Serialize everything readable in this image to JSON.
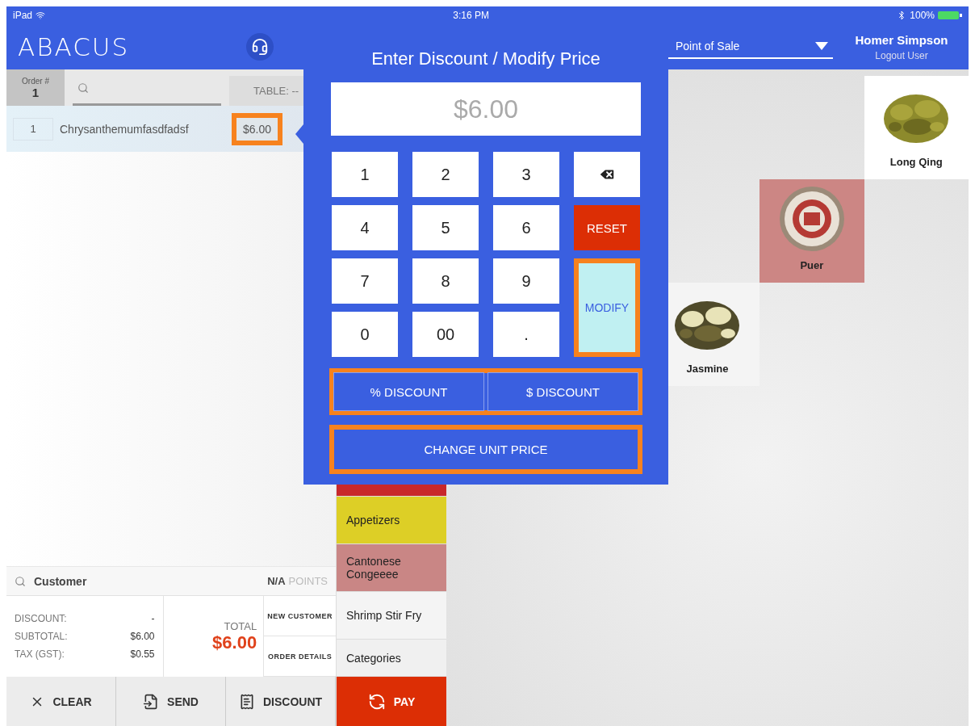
{
  "status_bar": {
    "device": "iPad",
    "time": "3:16 PM",
    "battery": "100%"
  },
  "header": {
    "logo": "ABACUS",
    "mode_select": {
      "value": "Point of Sale"
    },
    "user": {
      "name": "Homer Simpson",
      "logout": "Logout User"
    }
  },
  "order": {
    "number_label": "Order #",
    "number": "1",
    "table": "TABLE: --",
    "lines": [
      {
        "qty": "1",
        "name": "Chrysanthemumfasdfadsf",
        "price": "$6.00",
        "highlighted": true
      }
    ]
  },
  "customer": {
    "label": "Customer",
    "points_value": "N/A",
    "points_label": "POINTS"
  },
  "totals": [
    {
      "label": "DISCOUNT:",
      "value": "-"
    },
    {
      "label": "SUBTOTAL:",
      "value": "$6.00"
    },
    {
      "label": "TAX (GST):",
      "value": "$0.55"
    }
  ],
  "total": {
    "label": "TOTAL",
    "value": "$6.00"
  },
  "side_actions": [
    "NEW CUSTOMER",
    "ORDER DETAILS"
  ],
  "bottom_actions": [
    {
      "kind": "clear",
      "label": "CLEAR"
    },
    {
      "kind": "send",
      "label": "SEND"
    },
    {
      "kind": "discount",
      "label": "DISCOUNT"
    }
  ],
  "categories": [
    {
      "color": "#c8282a"
    },
    {
      "label": "Appetizers",
      "color": "#ddcf26"
    },
    {
      "label": "Cantonese Congeeee",
      "color": "#c98685"
    },
    {
      "label": "Shrimp Stir Fry",
      "color": "#f4f4f4"
    },
    {
      "label": "Categories",
      "color": "#f0f0f0"
    }
  ],
  "pay": {
    "label": "PAY"
  },
  "products": [
    {
      "name": "Long Qing",
      "color": "#ffffff",
      "kind": "picture"
    },
    {
      "name": "Puer",
      "color": "#cc8684",
      "kind": "picture"
    },
    {
      "name": "Jasmine",
      "color": "#f4f4f4",
      "kind": "picture"
    }
  ],
  "popover": {
    "title": "Enter Discount / Modify Price",
    "display": {
      "placeholder": "$6.00"
    },
    "keys": [
      {
        "kind": "digit",
        "label": "1"
      },
      {
        "kind": "digit",
        "label": "2"
      },
      {
        "kind": "digit",
        "label": "3"
      },
      {
        "kind": "backspace"
      },
      {
        "kind": "digit",
        "label": "4"
      },
      {
        "kind": "digit",
        "label": "5"
      },
      {
        "kind": "digit",
        "label": "6"
      },
      {
        "kind": "reset",
        "label": "RESET"
      },
      {
        "kind": "digit",
        "label": "7"
      },
      {
        "kind": "digit",
        "label": "8"
      },
      {
        "kind": "digit",
        "label": "9"
      },
      {
        "kind": "modify",
        "label": "MODIFY",
        "highlighted": true
      },
      {
        "kind": "digit",
        "label": "0"
      },
      {
        "kind": "digit",
        "label": "00"
      },
      {
        "kind": "digit",
        "label": "."
      }
    ],
    "discount_buttons": {
      "highlighted": true,
      "items": [
        "% DISCOUNT",
        "$ DISCOUNT"
      ]
    },
    "change_price": {
      "label": "CHANGE UNIT PRICE",
      "highlighted": true
    }
  }
}
